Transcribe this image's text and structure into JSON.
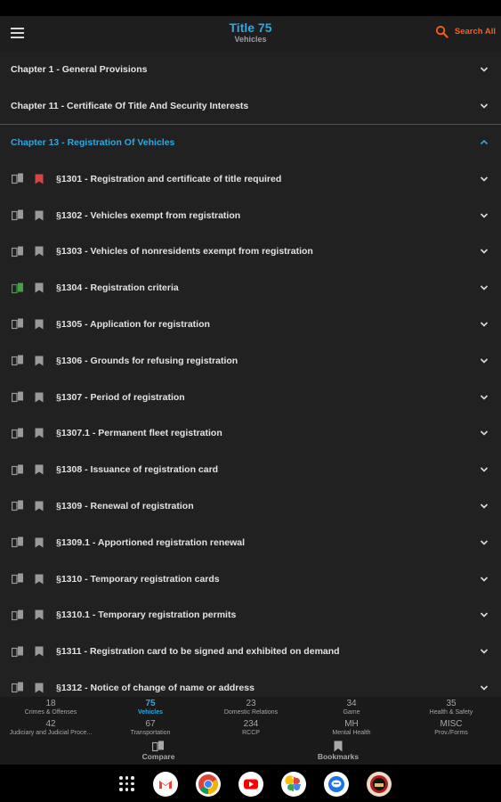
{
  "header": {
    "title": "Title 75",
    "subtitle": "Vehicles",
    "search_label": "Search All",
    "accent_color": "#2ea8e0",
    "search_color": "#f2611d"
  },
  "chapters_top": [
    {
      "label": "Chapter 1 - General Provisions"
    },
    {
      "label": "Chapter 11 - Certificate Of Title And Security Interests"
    }
  ],
  "active_chapter": {
    "label": "Chapter 13 - Registration Of Vehicles"
  },
  "sections": [
    {
      "label": "§1301 - Registration and certificate of title required",
      "bookmarked": true,
      "compare_active": false
    },
    {
      "label": "§1302 - Vehicles exempt from registration",
      "bookmarked": false,
      "compare_active": false
    },
    {
      "label": "§1303 - Vehicles of nonresidents exempt from registration",
      "bookmarked": false,
      "compare_active": false
    },
    {
      "label": "§1304 - Registration criteria",
      "bookmarked": false,
      "compare_active": true
    },
    {
      "label": "§1305 - Application for registration",
      "bookmarked": false,
      "compare_active": false
    },
    {
      "label": "§1306 - Grounds for refusing registration",
      "bookmarked": false,
      "compare_active": false
    },
    {
      "label": "§1307 - Period of registration",
      "bookmarked": false,
      "compare_active": false
    },
    {
      "label": "§1307.1 - Permanent fleet registration",
      "bookmarked": false,
      "compare_active": false
    },
    {
      "label": "§1308 - Issuance of registration card",
      "bookmarked": false,
      "compare_active": false
    },
    {
      "label": "§1309 - Renewal of registration",
      "bookmarked": false,
      "compare_active": false
    },
    {
      "label": "§1309.1 - Apportioned registration renewal",
      "bookmarked": false,
      "compare_active": false
    },
    {
      "label": "§1310 - Temporary registration cards",
      "bookmarked": false,
      "compare_active": false
    },
    {
      "label": "§1310.1 - Temporary registration permits",
      "bookmarked": false,
      "compare_active": false
    },
    {
      "label": "§1311 - Registration card to be signed and exhibited on demand",
      "bookmarked": false,
      "compare_active": false
    },
    {
      "label": "§1312 - Notice of change of name or address",
      "bookmarked": false,
      "compare_active": false
    }
  ],
  "title_bar": {
    "row1": [
      {
        "num": "18",
        "name": "Crimes & Offenses",
        "active": false
      },
      {
        "num": "75",
        "name": "Vehicles",
        "active": true
      },
      {
        "num": "23",
        "name": "Domestic Relations",
        "active": false
      },
      {
        "num": "34",
        "name": "Game",
        "active": false
      },
      {
        "num": "35",
        "name": "Health & Safety",
        "active": false
      }
    ],
    "row2": [
      {
        "num": "42",
        "name": "Judiciary and Judicial Proce...",
        "active": false
      },
      {
        "num": "67",
        "name": "Transportation",
        "active": false
      },
      {
        "num": "234",
        "name": "RCCP",
        "active": false
      },
      {
        "num": "MH",
        "name": "Mental Health",
        "active": false
      },
      {
        "num": "MISC",
        "name": "Prov./Forms",
        "active": false
      }
    ]
  },
  "bottom_nav": {
    "compare_label": "Compare",
    "bookmarks_label": "Bookmarks"
  },
  "colors": {
    "bookmark_active": "#d64541",
    "compare_active": "#43a047",
    "icon_default": "#9a9a9a"
  },
  "dock": {
    "apps": [
      "apps-grid-icon",
      "gmail-icon",
      "chrome-icon",
      "youtube-icon",
      "photos-icon",
      "messages-icon",
      "app-icon"
    ]
  }
}
